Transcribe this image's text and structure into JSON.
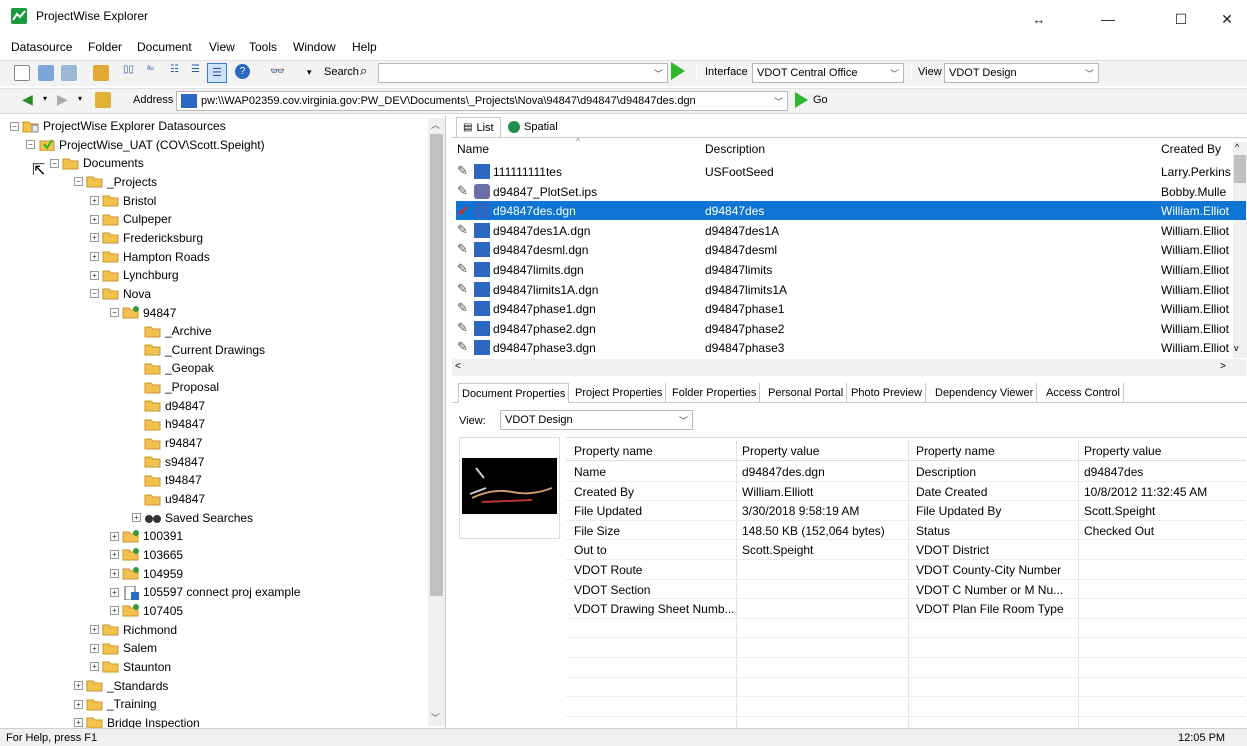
{
  "window": {
    "title": "ProjectWise Explorer",
    "resize_glyph": "↔",
    "minimize": "—",
    "maximize": "☐",
    "close": "✕"
  },
  "menu": [
    "Datasource",
    "Folder",
    "Document",
    "View",
    "Tools",
    "Window",
    "Help"
  ],
  "toolbar1": {
    "search_label": "Search",
    "interface_label": "Interface",
    "interface_value": "VDOT Central Office",
    "view_label": "View",
    "view_value": "VDOT Design"
  },
  "toolbar2": {
    "address_label": "Address",
    "address_value": "pw:\\\\WAP02359.cov.virginia.gov:PW_DEV\\Documents\\_Projects\\Nova\\94847\\d94847\\d94847des.dgn",
    "go_label": "Go"
  },
  "tree": [
    {
      "label": "ProjectWise Explorer Datasources",
      "level": 0,
      "icon": "datasources-icon",
      "exp": "-"
    },
    {
      "label": "ProjectWise_UAT (COV\\Scott.Speight)",
      "level": 1,
      "icon": "datasource-icon",
      "exp": "-"
    },
    {
      "label": "Documents",
      "level": 2,
      "icon": "folder-open-icon",
      "exp": "-"
    },
    {
      "label": "_Projects",
      "level": 3,
      "icon": "folder-open-icon",
      "exp": "-"
    },
    {
      "label": "Bristol",
      "level": 4,
      "icon": "folder-icon",
      "exp": "+"
    },
    {
      "label": "Culpeper",
      "level": 4,
      "icon": "folder-icon",
      "exp": "+"
    },
    {
      "label": "Fredericksburg",
      "level": 4,
      "icon": "folder-icon",
      "exp": "+"
    },
    {
      "label": "Hampton Roads",
      "level": 4,
      "icon": "folder-icon",
      "exp": "+"
    },
    {
      "label": "Lynchburg",
      "level": 4,
      "icon": "folder-icon",
      "exp": "+"
    },
    {
      "label": "Nova",
      "level": 4,
      "icon": "folder-open-icon",
      "exp": "-"
    },
    {
      "label": "94847",
      "level": 5,
      "icon": "project-folder-icon",
      "exp": "-"
    },
    {
      "label": "_Archive",
      "level": 6,
      "icon": "folder-icon",
      "exp": ""
    },
    {
      "label": "_Current Drawings",
      "level": 6,
      "icon": "folder-icon",
      "exp": ""
    },
    {
      "label": "_Geopak",
      "level": 6,
      "icon": "folder-icon",
      "exp": ""
    },
    {
      "label": "_Proposal",
      "level": 6,
      "icon": "folder-icon",
      "exp": ""
    },
    {
      "label": "d94847",
      "level": 6,
      "icon": "folder-icon",
      "exp": ""
    },
    {
      "label": "h94847",
      "level": 6,
      "icon": "folder-icon",
      "exp": ""
    },
    {
      "label": "r94847",
      "level": 6,
      "icon": "folder-icon",
      "exp": ""
    },
    {
      "label": "s94847",
      "level": 6,
      "icon": "folder-icon",
      "exp": ""
    },
    {
      "label": "t94847",
      "level": 6,
      "icon": "folder-icon",
      "exp": ""
    },
    {
      "label": "u94847",
      "level": 6,
      "icon": "folder-icon",
      "exp": ""
    },
    {
      "label": "Saved Searches",
      "level": 6,
      "icon": "binoculars-icon",
      "exp": "+"
    },
    {
      "label": "100391",
      "level": 5,
      "icon": "project-folder-icon",
      "exp": "+"
    },
    {
      "label": "103665",
      "level": 5,
      "icon": "project-folder-icon",
      "exp": "+"
    },
    {
      "label": "104959",
      "level": 5,
      "icon": "project-folder-icon",
      "exp": "+"
    },
    {
      "label": "105597 connect proj example",
      "level": 5,
      "icon": "connected-project-icon",
      "exp": "+"
    },
    {
      "label": "107405",
      "level": 5,
      "icon": "project-folder-icon",
      "exp": "+"
    },
    {
      "label": "Richmond",
      "level": 4,
      "icon": "folder-icon",
      "exp": "+"
    },
    {
      "label": "Salem",
      "level": 4,
      "icon": "folder-icon",
      "exp": "+"
    },
    {
      "label": "Staunton",
      "level": 4,
      "icon": "folder-icon",
      "exp": "+"
    },
    {
      "label": "_Standards",
      "level": 3,
      "icon": "folder-icon",
      "exp": "+"
    },
    {
      "label": "_Training",
      "level": 3,
      "icon": "folder-icon",
      "exp": "+"
    },
    {
      "label": "Bridge Inspection",
      "level": 3,
      "icon": "folder-icon",
      "exp": "+"
    }
  ],
  "view_tabs": [
    "List",
    "Spatial"
  ],
  "file_columns": [
    "Name",
    "Description",
    "Created By"
  ],
  "files": [
    {
      "name": "111111111tes",
      "description": "USFootSeed",
      "created_by": "Larry.Perkins",
      "selected": false,
      "icon": "dgn-icon"
    },
    {
      "name": "d94847_PlotSet.ips",
      "description": "",
      "created_by": "Bobby.Mulle",
      "selected": false,
      "icon": "plotset-icon"
    },
    {
      "name": "d94847des.dgn",
      "description": "d94847des",
      "created_by": "William.Elliot",
      "selected": true,
      "icon": "dgn-icon"
    },
    {
      "name": "d94847des1A.dgn",
      "description": "d94847des1A",
      "created_by": "William.Elliot",
      "selected": false,
      "icon": "dgn-icon"
    },
    {
      "name": "d94847desml.dgn",
      "description": "d94847desml",
      "created_by": "William.Elliot",
      "selected": false,
      "icon": "dgn-icon"
    },
    {
      "name": "d94847limits.dgn",
      "description": "d94847limits",
      "created_by": "William.Elliot",
      "selected": false,
      "icon": "dgn-icon"
    },
    {
      "name": "d94847limits1A.dgn",
      "description": "d94847limits1A",
      "created_by": "William.Elliot",
      "selected": false,
      "icon": "dgn-icon"
    },
    {
      "name": "d94847phase1.dgn",
      "description": "d94847phase1",
      "created_by": "William.Elliot",
      "selected": false,
      "icon": "dgn-icon"
    },
    {
      "name": "d94847phase2.dgn",
      "description": "d94847phase2",
      "created_by": "William.Elliot",
      "selected": false,
      "icon": "dgn-icon"
    },
    {
      "name": "d94847phase3.dgn",
      "description": "d94847phase3",
      "created_by": "William.Elliot",
      "selected": false,
      "icon": "dgn-icon"
    }
  ],
  "property_tabs": [
    "Document Properties",
    "Project Properties",
    "Folder Properties",
    "Personal Portal",
    "Photo Preview",
    "Dependency Viewer",
    "Access Control"
  ],
  "properties_view": {
    "label": "View:",
    "value": "VDOT Design"
  },
  "property_headers": [
    "Property name",
    "Property value",
    "Property name",
    "Property value"
  ],
  "properties": [
    [
      "Name",
      "d94847des.dgn",
      "Description",
      "d94847des"
    ],
    [
      "Created By",
      "William.Elliott",
      "Date Created",
      "10/8/2012 11:32:45 AM"
    ],
    [
      "File Updated",
      "3/30/2018 9:58:19 AM",
      "File Updated By",
      "Scott.Speight"
    ],
    [
      "File Size",
      "148.50 KB (152,064 bytes)",
      "Status",
      "Checked Out"
    ],
    [
      "Out to",
      "Scott.Speight",
      "VDOT District",
      ""
    ],
    [
      "VDOT Route",
      "",
      "VDOT County-City Number",
      ""
    ],
    [
      "VDOT Section",
      "",
      "VDOT C Number or M Nu...",
      ""
    ],
    [
      "VDOT Drawing Sheet Numb...",
      "",
      "VDOT Plan File Room Type",
      ""
    ]
  ],
  "status": {
    "help": "For Help, press F1",
    "time": "12:05 PM"
  },
  "colors": {
    "selection": "#0f75d5",
    "folder": "#f2c14e",
    "checkout_mark": "#d22b1e",
    "go_arrow": "#2eb82e"
  }
}
